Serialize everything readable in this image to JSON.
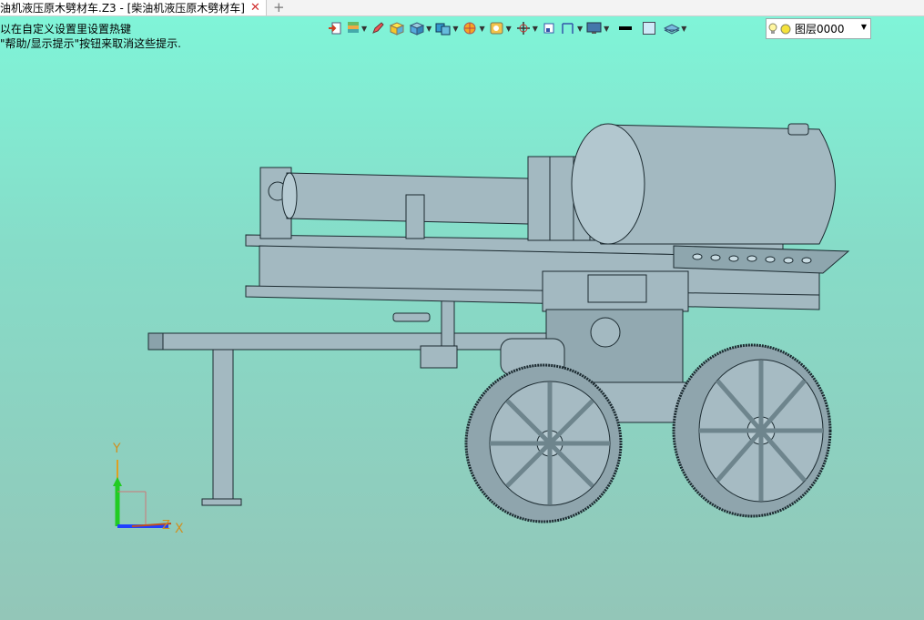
{
  "tab": {
    "title": "油机液压原木劈材车.Z3 - [柴油机液压原木劈材车]",
    "close_glyph": "✕",
    "new_tab_glyph": "+"
  },
  "hints": [
    "以在自定义设置里设置热键",
    "\"帮助/显示提示\"按钮来取消这些提示."
  ],
  "toolbar": {
    "icons": [
      "import-icon",
      "layers-stack-icon",
      "pen-icon",
      "cube-yellow-icon",
      "cube-blue-icon",
      "views-icon",
      "render-ball-icon",
      "display-mode-icon",
      "move-icon",
      "frame-icon",
      "dimension-icon",
      "screen-icon",
      "line-color-icon",
      "face-color-icon",
      "layer-tool-icon"
    ]
  },
  "layer_selector": {
    "value": "图层0000"
  },
  "axes": {
    "y": "Y",
    "z": "Z",
    "x": "X"
  },
  "colors": {
    "accent_green_top": "#7ff6d9",
    "model_fill": "#9fb5bd",
    "model_stroke": "#1a2a30"
  }
}
